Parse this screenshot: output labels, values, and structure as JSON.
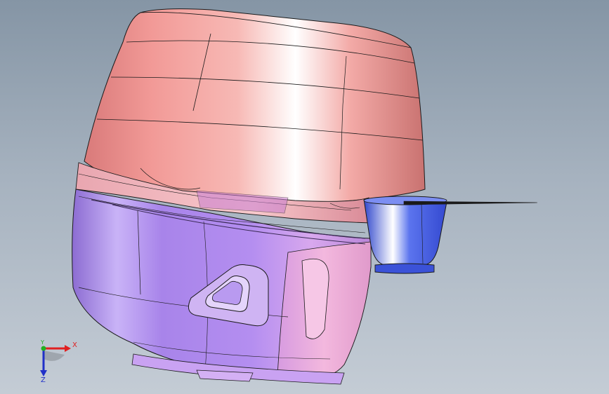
{
  "viewport": {
    "background_top": "#8595a5",
    "background_bottom": "#c4ccd5"
  },
  "model": {
    "upper_shell_color": "#f09a9a",
    "lower_shell_color": "#b99af0",
    "cup_color": "#4a62e6",
    "edge_color": "#1a1a1a"
  },
  "triad": {
    "x_label": "X",
    "y_label": "Y",
    "z_label": "Z",
    "x_color": "#e02020",
    "y_color": "#20b020",
    "z_color": "#2030c8"
  }
}
